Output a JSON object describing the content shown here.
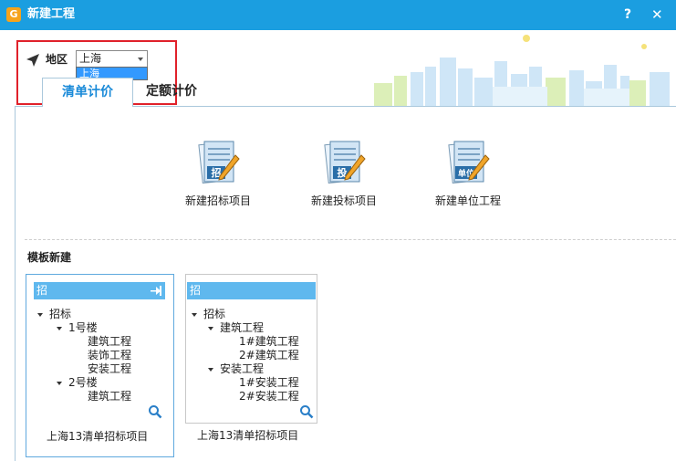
{
  "window": {
    "title": "新建工程",
    "help_label": "?",
    "close_label": "✕",
    "logo_glyph": "G"
  },
  "region": {
    "label": "地区",
    "selected": "上海",
    "option_highlighted": "上海"
  },
  "tabs": [
    {
      "label": "清单计价",
      "active": true
    },
    {
      "label": "定额计价",
      "active": false
    }
  ],
  "actions": [
    {
      "label": "新建招标项目",
      "badge": "招",
      "icon": "document-pencil-icon"
    },
    {
      "label": "新建投标项目",
      "badge": "投",
      "icon": "document-pencil-icon"
    },
    {
      "label": "新建单位工程",
      "badge": "单位",
      "icon": "document-pencil-icon"
    }
  ],
  "templates": {
    "title": "模板新建",
    "cards": [
      {
        "header": "招",
        "tree": [
          {
            "text": "招标",
            "level": 0,
            "expandable": true
          },
          {
            "text": "1号楼",
            "level": 1,
            "expandable": true
          },
          {
            "text": "建筑工程",
            "level": 2,
            "expandable": false
          },
          {
            "text": "装饰工程",
            "level": 2,
            "expandable": false
          },
          {
            "text": "安装工程",
            "level": 2,
            "expandable": false
          },
          {
            "text": "2号楼",
            "level": 1,
            "expandable": true
          },
          {
            "text": "建筑工程",
            "level": 2,
            "expandable": false
          }
        ],
        "caption": "上海13清单招标项目"
      },
      {
        "header": "招",
        "tree": [
          {
            "text": "招标",
            "level": 0,
            "expandable": true
          },
          {
            "text": "建筑工程",
            "level": 1,
            "expandable": true
          },
          {
            "text": "1#建筑工程",
            "level": 2,
            "expandable": false
          },
          {
            "text": "2#建筑工程",
            "level": 2,
            "expandable": false
          },
          {
            "text": "安装工程",
            "level": 1,
            "expandable": true
          },
          {
            "text": "1#安装工程",
            "level": 2,
            "expandable": false
          },
          {
            "text": "2#安装工程",
            "level": 2,
            "expandable": false
          }
        ],
        "caption": "上海13清单招标项目"
      }
    ]
  },
  "colors": {
    "titlebar": "#1b9ee0",
    "accent": "#1a8ad8",
    "card_header": "#5fb8ee",
    "highlight_box": "#e0212a"
  }
}
